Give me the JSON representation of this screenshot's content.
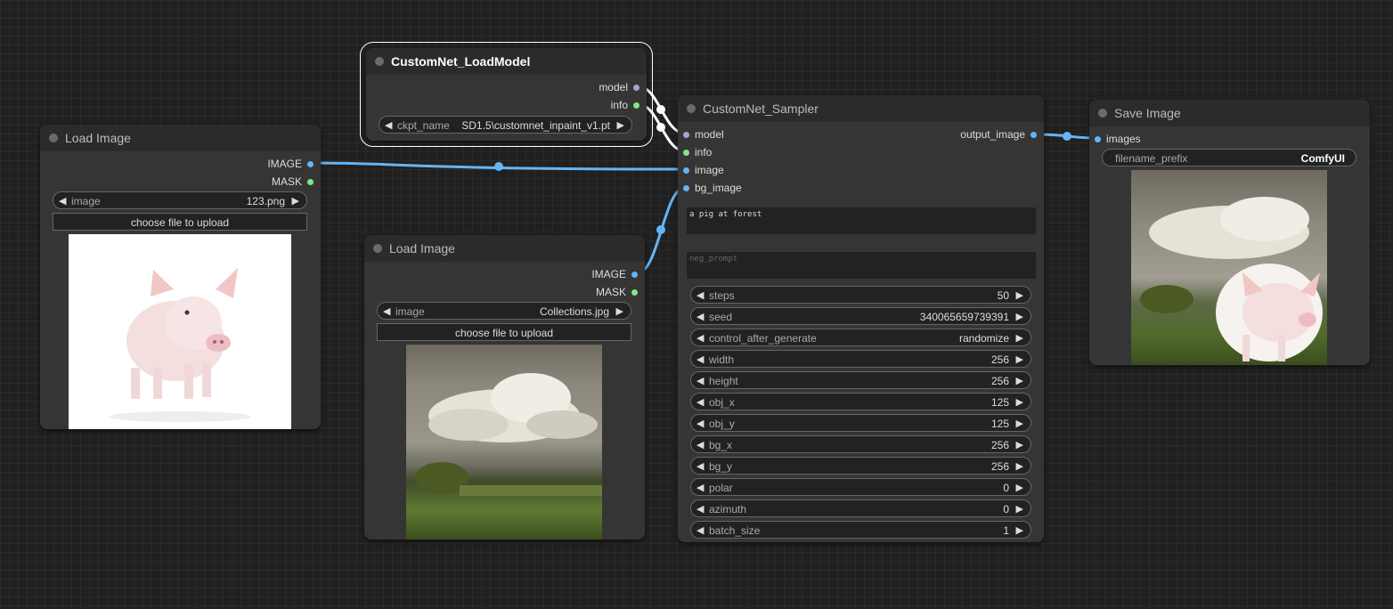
{
  "load_model": {
    "title": "CustomNet_LoadModel",
    "outputs": [
      "model",
      "info"
    ],
    "ckpt_label": "ckpt_name",
    "ckpt_value": "SD1.5\\customnet_inpaint_v1.pt"
  },
  "load_image_1": {
    "title": "Load Image",
    "outputs": [
      "IMAGE",
      "MASK"
    ],
    "image_label": "image",
    "image_value": "123.png",
    "upload_label": "choose file to upload",
    "preview": "pig-photo"
  },
  "load_image_2": {
    "title": "Load Image",
    "outputs": [
      "IMAGE",
      "MASK"
    ],
    "image_label": "image",
    "image_value": "Collections.jpg",
    "upload_label": "choose file to upload",
    "preview": "clouds-landscape-photo"
  },
  "sampler": {
    "title": "CustomNet_Sampler",
    "inputs": [
      "model",
      "info",
      "image",
      "bg_image"
    ],
    "output": "output_image",
    "prompt": "a pig at forest",
    "neg_prompt_placeholder": "neg_prompt",
    "widgets": [
      {
        "label": "steps",
        "value": "50"
      },
      {
        "label": "seed",
        "value": "340065659739391"
      },
      {
        "label": "control_after_generate",
        "value": "randomize"
      },
      {
        "label": "width",
        "value": "256"
      },
      {
        "label": "height",
        "value": "256"
      },
      {
        "label": "obj_x",
        "value": "125"
      },
      {
        "label": "obj_y",
        "value": "125"
      },
      {
        "label": "bg_x",
        "value": "256"
      },
      {
        "label": "bg_y",
        "value": "256"
      },
      {
        "label": "polar",
        "value": "0"
      },
      {
        "label": "azimuth",
        "value": "0"
      },
      {
        "label": "batch_size",
        "value": "1"
      }
    ]
  },
  "save_image": {
    "title": "Save Image",
    "input": "images",
    "prefix_label": "filename_prefix",
    "prefix_value": "ComfyUI",
    "preview": "pig-in-landscape-output"
  },
  "colors": {
    "image_link": "#64b5f6",
    "info_pin": "#7ee787",
    "model_pin": "#b39ddb",
    "canvas": "#202020",
    "node": "#353535"
  }
}
